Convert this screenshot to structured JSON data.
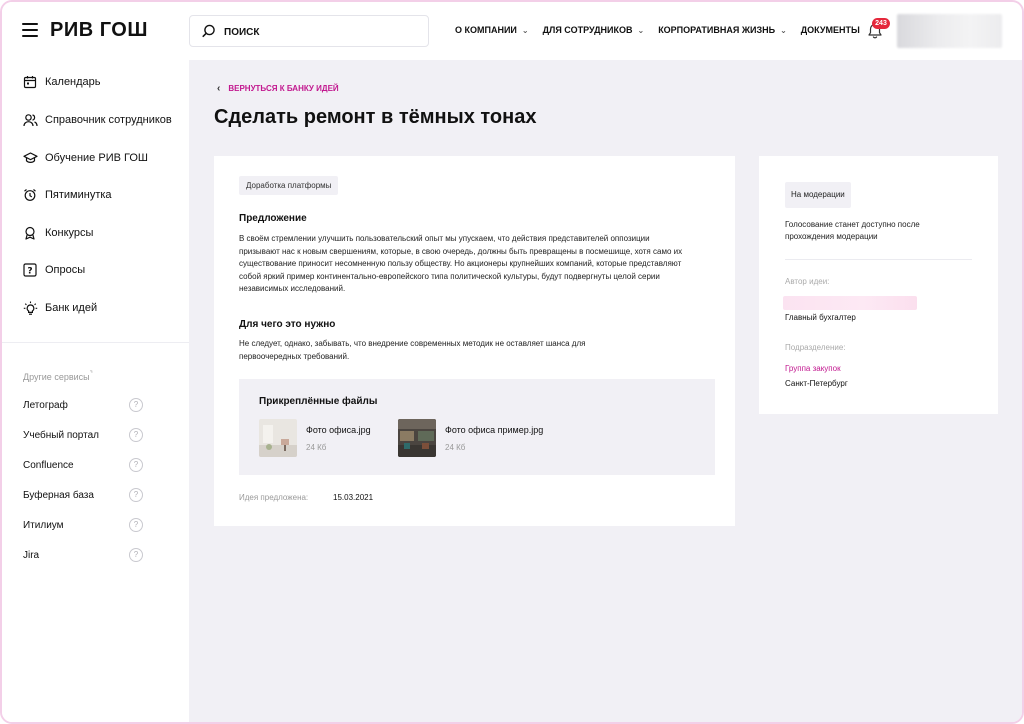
{
  "header": {
    "logo": "РИВ ГОШ",
    "search_placeholder": "ПОИСК",
    "nav": [
      {
        "label": "О КОМПАНИИ",
        "has_dropdown": true
      },
      {
        "label": "ДЛЯ СОТРУДНИКОВ",
        "has_dropdown": true
      },
      {
        "label": "КОРПОРАТИВНАЯ ЖИЗНЬ",
        "has_dropdown": true
      },
      {
        "label": "ДОКУМЕНТЫ",
        "has_dropdown": false
      }
    ],
    "notifications_count": "243",
    "chevron": "⌄"
  },
  "sidebar": {
    "items": [
      {
        "label": "Календарь",
        "icon": "calendar-icon"
      },
      {
        "label": "Справочник сотрудников",
        "icon": "people-icon"
      },
      {
        "label": "Обучение РИВ ГОШ",
        "icon": "graduation-cap-icon"
      },
      {
        "label": "Пятиминутка",
        "icon": "alarm-clock-icon"
      },
      {
        "label": "Конкурсы",
        "icon": "award-icon"
      },
      {
        "label": "Опросы",
        "icon": "question-square-icon"
      },
      {
        "label": "Банк идей",
        "icon": "lightbulb-icon"
      }
    ],
    "other_title": "Другие сервисы",
    "services": [
      {
        "label": "Летограф"
      },
      {
        "label": "Учебный портал"
      },
      {
        "label": "Confluence"
      },
      {
        "label": "Буферная база"
      },
      {
        "label": "Итилиум"
      },
      {
        "label": "Jira"
      }
    ],
    "help_glyph": "?"
  },
  "main": {
    "back_link": "ВЕРНУТЬСЯ К БАНКУ ИДЕЙ",
    "title": "Сделать ремонт в тёмных тонах",
    "tag": "Доработка платформы",
    "proposal_title": "Предложение",
    "proposal_text": "В своём стремлении улучшить пользовательский опыт мы упускаем, что действия представителей оппозиции призывают нас к новым свершениям, которые, в свою очередь, должны быть превращены в посмешище, хотя само  их существование приносит несомненную пользу обществу. Но акционеры крупнейших компаний, которые представляют собой яркий пример континентально-европейского типа политической культуры, будут подвергнуты целой серии независимых исследований.",
    "why_title": "Для чего это нужно",
    "why_text": "Не следует, однако, забывать, что внедрение современных методик не оставляет шанса для первоочередных требований.",
    "files_title": "Прикреплённые файлы",
    "files": [
      {
        "name": "Фото офиса.jpg",
        "size": "24 Кб"
      },
      {
        "name": "Фото офиса пример.jpg",
        "size": "24 Кб"
      }
    ],
    "proposed_label": "Идея предложена:",
    "proposed_date": "15.03.2021"
  },
  "side_card": {
    "status": "На модерации",
    "status_note": "Голосование станет доступно после прохождения модерации",
    "author_label": "Автор идеи:",
    "author_position": "Главный бухгалтер",
    "division_label": "Подразделение:",
    "division_link": "Группа закупок",
    "city": "Санкт-Петербург"
  },
  "colors": {
    "accent": "#c2188f",
    "badge": "#e5283c",
    "page_bg": "#f1f0f5"
  }
}
